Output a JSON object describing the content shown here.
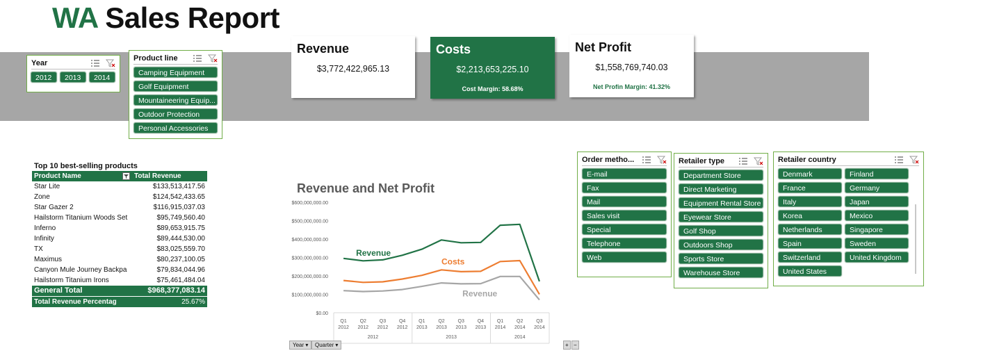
{
  "title": {
    "prefix": "WA",
    "rest": "Sales Report"
  },
  "slicers": {
    "year": {
      "title": "Year",
      "items": [
        "2012",
        "2013",
        "2014"
      ]
    },
    "product_line": {
      "title": "Product line",
      "items": [
        "Camping Equipment",
        "Golf Equipment",
        "Mountaineering Equip...",
        "Outdoor Protection",
        "Personal Accessories"
      ]
    },
    "order_method": {
      "title": "Order metho...",
      "items": [
        "E-mail",
        "Fax",
        "Mail",
        "Sales visit",
        "Special",
        "Telephone",
        "Web"
      ]
    },
    "retailer_type": {
      "title": "Retailer type",
      "items": [
        "Department Store",
        "Direct Marketing",
        "Equipment Rental Store",
        "Eyewear Store",
        "Golf Shop",
        "Outdoors Shop",
        "Sports Store",
        "Warehouse Store"
      ]
    },
    "retailer_country": {
      "title": "Retailer country",
      "items": [
        "Denmark",
        "Finland",
        "France",
        "Germany",
        "Italy",
        "Japan",
        "Korea",
        "Mexico",
        "Netherlands",
        "Singapore",
        "Spain",
        "Sweden",
        "Switzerland",
        "United Kingdom",
        "United States"
      ]
    }
  },
  "kpis": {
    "revenue": {
      "title": "Revenue",
      "value": "$3,772,422,965.13"
    },
    "costs": {
      "title": "Costs",
      "value": "$2,213,653,225.10",
      "sub": "Cost Margin: 58.68%"
    },
    "net_profit": {
      "title": "Net Profit",
      "value": "$1,558,769,740.03",
      "sub": "Net Profin Margin: 41.32%"
    }
  },
  "top10": {
    "title": "Top 10 best-selling products",
    "headers": [
      "Product Name",
      "Total Revenue"
    ],
    "rows": [
      [
        "Star Lite",
        "$133,513,417.56"
      ],
      [
        "Zone",
        "$124,542,433.65"
      ],
      [
        "Star Gazer 2",
        "$116,915,037.03"
      ],
      [
        "Hailstorm Titanium Woods Set",
        "$95,749,560.40"
      ],
      [
        "Inferno",
        "$89,653,915.75"
      ],
      [
        "Infinity",
        "$89,444,530.00"
      ],
      [
        "TX",
        "$83,025,559.70"
      ],
      [
        "Maximus",
        "$80,237,100.05"
      ],
      [
        "Canyon Mule Journey Backpa",
        "$79,834,044.96"
      ],
      [
        "Hailstorm Titanium Irons",
        "$75,461,484.04"
      ]
    ],
    "total_label": "General Total",
    "total_value": "$968,377,083.14",
    "pct_label": "Total Revenue Percentag",
    "pct_value": "25.67%"
  },
  "chart_data": {
    "type": "line",
    "title": "Revenue and Net Profit",
    "x": [
      "Q1 2012",
      "Q2 2012",
      "Q3 2012",
      "Q4 2012",
      "Q1 2013",
      "Q2 2013",
      "Q3 2013",
      "Q4 2013",
      "Q1 2014",
      "Q2 2014",
      "Q3 2014"
    ],
    "x_quarters": [
      "Q1",
      "Q2",
      "Q3",
      "Q4",
      "Q1",
      "Q2",
      "Q3",
      "Q4",
      "Q1",
      "Q2",
      "Q3"
    ],
    "x_years": [
      "2012",
      "2012",
      "2012",
      "2012",
      "2013",
      "2013",
      "2013",
      "2013",
      "2014",
      "2014",
      "2014"
    ],
    "year_groups": [
      "2012",
      "2013",
      "2014"
    ],
    "y_ticks": [
      "$0.00",
      "$100,000,000.00",
      "$200,000,000.00",
      "$300,000,000.00",
      "$400,000,000.00",
      "$500,000,000.00",
      "$600,000,000.00"
    ],
    "ylim": [
      0,
      600000000
    ],
    "series": [
      {
        "name": "Revenue",
        "color": "#217346",
        "values": [
          295000000,
          282000000,
          287000000,
          312000000,
          345000000,
          395000000,
          380000000,
          382000000,
          475000000,
          480000000,
          170000000
        ]
      },
      {
        "name": "Costs",
        "color": "#ed7d31",
        "values": [
          175000000,
          165000000,
          168000000,
          183000000,
          203000000,
          233000000,
          223000000,
          225000000,
          278000000,
          283000000,
          100000000
        ]
      },
      {
        "name": "Revenue",
        "color": "#a6a6a6",
        "values": [
          120000000,
          115000000,
          118000000,
          126000000,
          143000000,
          162000000,
          157000000,
          158000000,
          197000000,
          197000000,
          70000000
        ]
      }
    ],
    "field_buttons": [
      "Year",
      "Quarter"
    ]
  },
  "colors": {
    "accent": "#217346",
    "band": "#a6a6a6",
    "costs": "#ed7d31",
    "gray_series": "#a6a6a6"
  }
}
